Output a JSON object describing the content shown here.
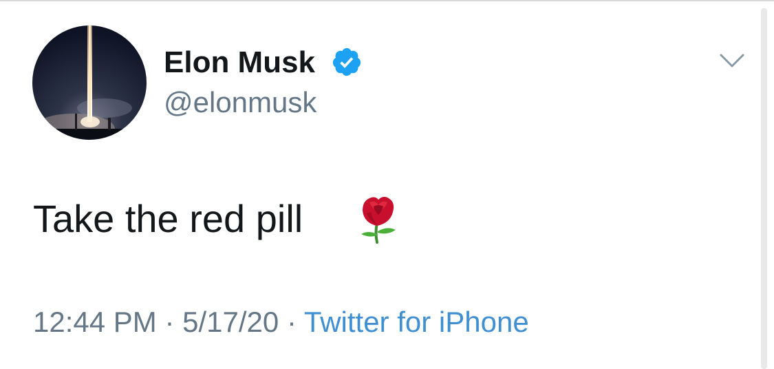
{
  "tweet": {
    "author": {
      "name": "Elon Musk",
      "handle": "@elonmusk",
      "verified": true
    },
    "text": "Take the red pill",
    "emoji": "rose-emoji",
    "time": "12:44 PM",
    "date": "5/17/20",
    "separator": "·",
    "source": "Twitter for iPhone"
  },
  "icons": {
    "verified": "verified-badge-icon",
    "menu": "chevron-down-icon"
  },
  "colors": {
    "name_text": "#14171a",
    "secondary_text": "#657786",
    "link": "#3f8fd2",
    "verified_badge": "#1da1f2"
  }
}
